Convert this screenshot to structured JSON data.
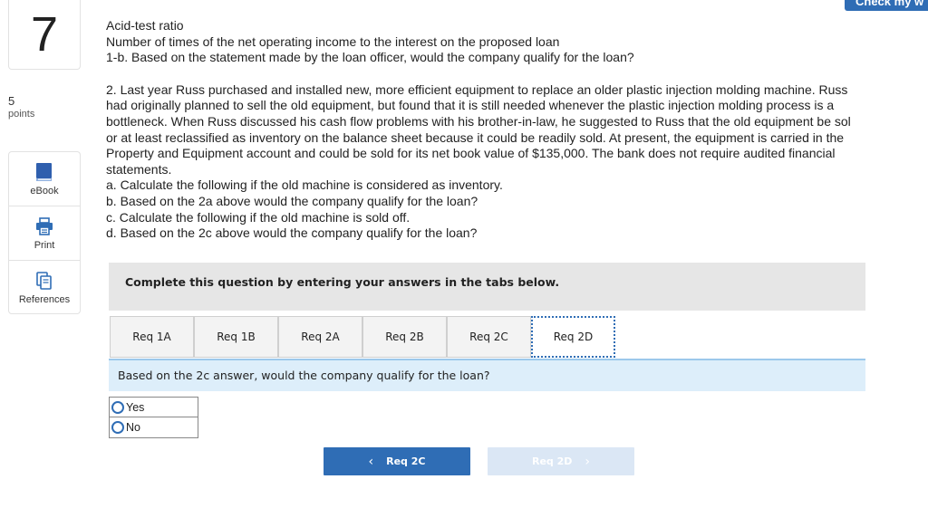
{
  "header": {
    "check_button_label": "Check my w"
  },
  "question": {
    "number": "7",
    "points_value": "5",
    "points_label": "points"
  },
  "tools": [
    {
      "label": "eBook",
      "icon": "ebook-icon"
    },
    {
      "label": "Print",
      "icon": "print-icon"
    },
    {
      "label": "References",
      "icon": "references-icon"
    }
  ],
  "body": {
    "lines_top": [
      "Acid-test ratio",
      "Number of times of the net operating income to the interest on the proposed loan",
      "1-b. Based on the statement made by the loan officer, would the company qualify for the loan?"
    ],
    "lines_main": [
      "2. Last year Russ purchased and installed new, more efficient equipment to replace an older plastic injection molding machine. Russ",
      "had originally planned to sell the old equipment, but found that it is still needed whenever the plastic injection molding process is a",
      "bottleneck. When Russ discussed his cash flow problems with his brother-in-law, he suggested to Russ that the old equipment be sol",
      "or at least reclassified as inventory on the balance sheet because it could be readily sold. At present, the equipment is carried in the",
      "Property and Equipment account and could be sold for its net book value of $135,000. The bank does not require audited financial",
      "statements.",
      "a. Calculate the following if the old machine is considered as inventory.",
      "b. Based on the 2a above would the company qualify for the loan?",
      "c. Calculate the following if the old machine is sold off.",
      "d. Based on the 2c above would the company qualify for the loan?"
    ]
  },
  "panel": {
    "instruction": "Complete this question by entering your answers in the tabs below.",
    "tabs": [
      "Req 1A",
      "Req 1B",
      "Req 2A",
      "Req 2B",
      "Req 2C",
      "Req 2D"
    ],
    "active_tab": "Req 2D",
    "prompt": "Based on the 2c answer, would the company qualify for the loan?",
    "choices": [
      "Yes",
      "No"
    ],
    "prev_label": "Req 2C",
    "next_label": "Req 2D"
  },
  "colors": {
    "accent": "#2f6db5",
    "prompt_bg": "#ddeefa",
    "instruction_bg": "#e6e6e6",
    "next_disabled_bg": "#dbe7f5"
  }
}
